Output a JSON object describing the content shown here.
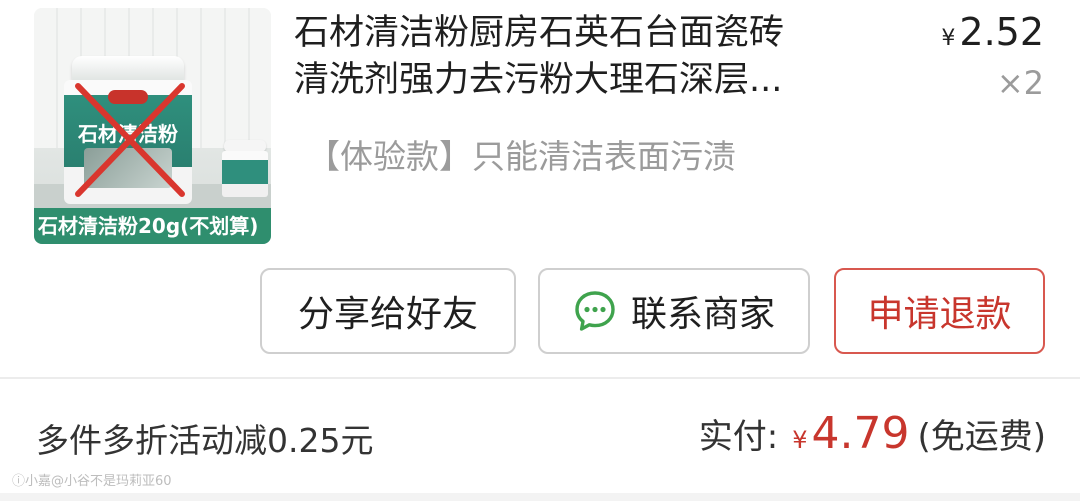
{
  "product": {
    "image_caption": "石材清洁粉20g(不划算)",
    "jar_label": "石材清洁粉",
    "title_line1": "石材清洁粉厨房石英石台面瓷砖",
    "title_line2": "清洗剂强力去污粉大理石深层...",
    "sku": "【体验款】只能清洁表面污渍",
    "currency_symbol": "¥",
    "unit_price": "2.52",
    "quantity": "×2"
  },
  "actions": {
    "share_label": "分享给好友",
    "contact_label": "联系商家",
    "refund_label": "申请退款"
  },
  "summary": {
    "discount_text": "多件多折活动减0.25元",
    "paid_label": "实付:",
    "paid_currency": "¥",
    "paid_amount": "4.79",
    "shipping_note": "(免运费)"
  },
  "watermark": "ⓘ小嘉@小谷不是玛莉亚60",
  "colors": {
    "accent_red": "#c8362d",
    "chat_green": "#3fa34d",
    "caption_green": "#2f8e6e"
  },
  "icons": {
    "contact": "chat-bubble-icon",
    "image_overlay": "red-cross-mark"
  }
}
